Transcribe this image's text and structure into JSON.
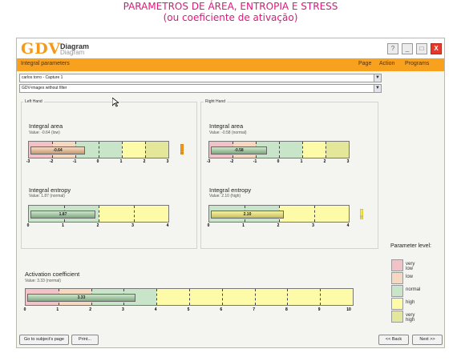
{
  "caption": {
    "line1": "PARAMETROS DE ÁREA, ENTROPIA E STRESS",
    "line2": "(ou coeficiente de ativação)"
  },
  "app": {
    "logo": "GDV",
    "name": "Diagram",
    "name_sub": "Diagram",
    "section": "Integral parameters",
    "menu": [
      "Page",
      "Action",
      "Programs"
    ],
    "window_buttons": [
      "?",
      "_",
      "□",
      "X"
    ]
  },
  "selects": {
    "capture": "carlos torro - Capture 1",
    "filter": "GDV-images without filter"
  },
  "hands": {
    "left": "Left Hand",
    "right": "Right Hand"
  },
  "panels": {
    "left_area": {
      "title": "Integral area",
      "value_text": "Value: -0.64 (low)",
      "value": -0.64,
      "bar_label": "-0.64",
      "status": "low"
    },
    "right_area": {
      "title": "Integral area",
      "value_text": "Value: -0.58 (normal)",
      "value": -0.58,
      "bar_label": "-0.58",
      "status": "normal"
    },
    "left_entropy": {
      "title": "Integral entropy",
      "value_text": "Value: 1.87 (normal)",
      "value": 1.87,
      "bar_label": "1.87",
      "status": "normal"
    },
    "right_entropy": {
      "title": "Integral entropy",
      "value_text": "Value: 2.10 (high)",
      "value": 2.1,
      "bar_label": "2.10",
      "status": "high"
    },
    "activation": {
      "title": "Activation coefficient",
      "value_text": "Value: 3.33 (normal)",
      "value": 3.33,
      "bar_label": "3.33",
      "status": "normal"
    }
  },
  "axes": {
    "area": [
      "-3",
      "-2",
      "-1",
      "0",
      "1",
      "2",
      "3"
    ],
    "entropy": [
      "0",
      "1",
      "2",
      "3",
      "4"
    ],
    "activation": [
      "0",
      "1",
      "2",
      "3",
      "4",
      "5",
      "6",
      "7",
      "8",
      "9",
      "10"
    ]
  },
  "legend": {
    "title": "Parameter level:",
    "items": [
      {
        "label": "very low",
        "color": "#f1c3c6"
      },
      {
        "label": "low",
        "color": "#f5d8bf"
      },
      {
        "label": "normal",
        "color": "#c8e4c9"
      },
      {
        "label": "high",
        "color": "#fdfaa8"
      },
      {
        "label": "very high",
        "color": "#e4e79a"
      }
    ]
  },
  "buttons": {
    "subject": "Go to subject's page",
    "print": "Print...",
    "back": "<< Back",
    "next": "Next >>"
  },
  "colors": {
    "accent": "#f7a11f",
    "caption": "#e0157a",
    "alert": "#f39a1e"
  }
}
